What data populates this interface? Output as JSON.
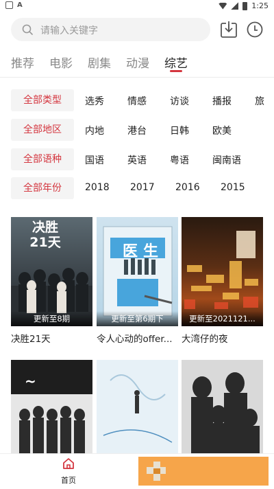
{
  "status_bar": {
    "time": "1:25"
  },
  "search": {
    "placeholder": "请输入关键字"
  },
  "tabs": [
    {
      "label": "推荐"
    },
    {
      "label": "电影"
    },
    {
      "label": "剧集"
    },
    {
      "label": "动漫"
    },
    {
      "label": "综艺",
      "active": true
    }
  ],
  "filters": [
    {
      "label": "全部类型",
      "options": [
        "选秀",
        "情感",
        "访谈",
        "播报",
        "旅"
      ]
    },
    {
      "label": "全部地区",
      "options": [
        "内地",
        "港台",
        "日韩",
        "欧美"
      ]
    },
    {
      "label": "全部语种",
      "options": [
        "国语",
        "英语",
        "粤语",
        "闽南语"
      ]
    },
    {
      "label": "全部年份",
      "options": [
        "2018",
        "2017",
        "2016",
        "2015"
      ]
    }
  ],
  "items": [
    {
      "title": "决胜21天",
      "badge": "更新至8期",
      "poster_text": "决胜 21天"
    },
    {
      "title": "令人心动的offer...",
      "badge": "更新至第6期下",
      "poster_text": "医生"
    },
    {
      "title": "大湾仔的夜",
      "badge": "更新至2021121...",
      "poster_text": ""
    },
    {
      "title": "",
      "badge": "",
      "poster_text": ""
    },
    {
      "title": "",
      "badge": "",
      "poster_text": ""
    },
    {
      "title": "",
      "badge": "",
      "poster_text": ""
    }
  ],
  "bottom_nav": {
    "home_label": "首页"
  },
  "colors": {
    "accent": "#d4363f"
  }
}
